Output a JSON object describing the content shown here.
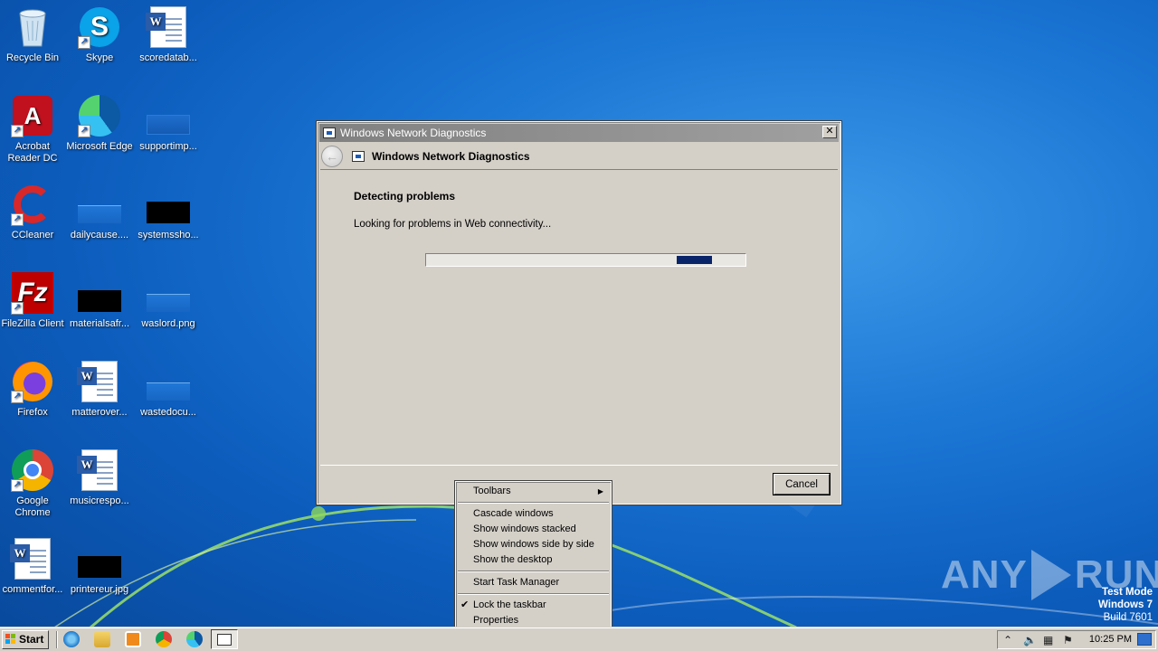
{
  "desktop": {
    "icons": [
      {
        "label": "Recycle Bin",
        "icon": "recycle-bin-icon"
      },
      {
        "label": "Skype",
        "icon": "skype-icon"
      },
      {
        "label": "scoredatab...",
        "icon": "word-document-icon"
      },
      {
        "label": "Acrobat Reader DC",
        "icon": "acrobat-icon"
      },
      {
        "label": "Microsoft Edge",
        "icon": "edge-icon"
      },
      {
        "label": "supportimp...",
        "icon": "image-file-icon"
      },
      {
        "label": "CCleaner",
        "icon": "ccleaner-icon"
      },
      {
        "label": "dailycause....",
        "icon": "image-file-icon"
      },
      {
        "label": "systemssho...",
        "icon": "image-file-icon"
      },
      {
        "label": "FileZilla Client",
        "icon": "filezilla-icon"
      },
      {
        "label": "materialsafr...",
        "icon": "image-file-icon"
      },
      {
        "label": "waslord.png",
        "icon": "image-file-icon"
      },
      {
        "label": "Firefox",
        "icon": "firefox-icon"
      },
      {
        "label": "matterover...",
        "icon": "word-document-icon"
      },
      {
        "label": "wastedocu...",
        "icon": "image-file-icon"
      },
      {
        "label": "Google Chrome",
        "icon": "chrome-icon"
      },
      {
        "label": "musicrespo...",
        "icon": "word-document-icon"
      },
      {
        "label": "commentfor...",
        "icon": "word-document-icon"
      },
      {
        "label": "printereur.jpg",
        "icon": "image-file-icon"
      }
    ]
  },
  "dialog": {
    "window_title": "Windows Network Diagnostics",
    "header_title": "Windows Network Diagnostics",
    "close_label": "✕",
    "heading": "Detecting problems",
    "status": "Looking for problems in Web connectivity...",
    "progress_segment_start": 0.785,
    "progress_segment_end": 0.895,
    "cancel_label": "Cancel"
  },
  "context_menu": {
    "toolbars": "Toolbars",
    "cascade": "Cascade windows",
    "stacked": "Show windows stacked",
    "side_by_side": "Show windows side by side",
    "show_desktop": "Show the desktop",
    "task_manager": "Start Task Manager",
    "lock_taskbar": "Lock the taskbar",
    "properties": "Properties"
  },
  "watermark": {
    "brand_left": "ANY",
    "brand_right": "RUN",
    "line1": "Test Mode",
    "line2": "Windows 7",
    "line3": "Build 7601"
  },
  "taskbar": {
    "start_label": "Start",
    "clock": "10:25 PM",
    "pinned": [
      "internet-explorer-icon",
      "file-explorer-icon",
      "media-player-icon",
      "chrome-icon",
      "edge-icon",
      "network-diagnostics-icon"
    ]
  },
  "colors": {
    "desktop_blue": "#1b76d4",
    "dialog_gray": "#d4d0c8",
    "progress_fill": "#0a246a"
  }
}
